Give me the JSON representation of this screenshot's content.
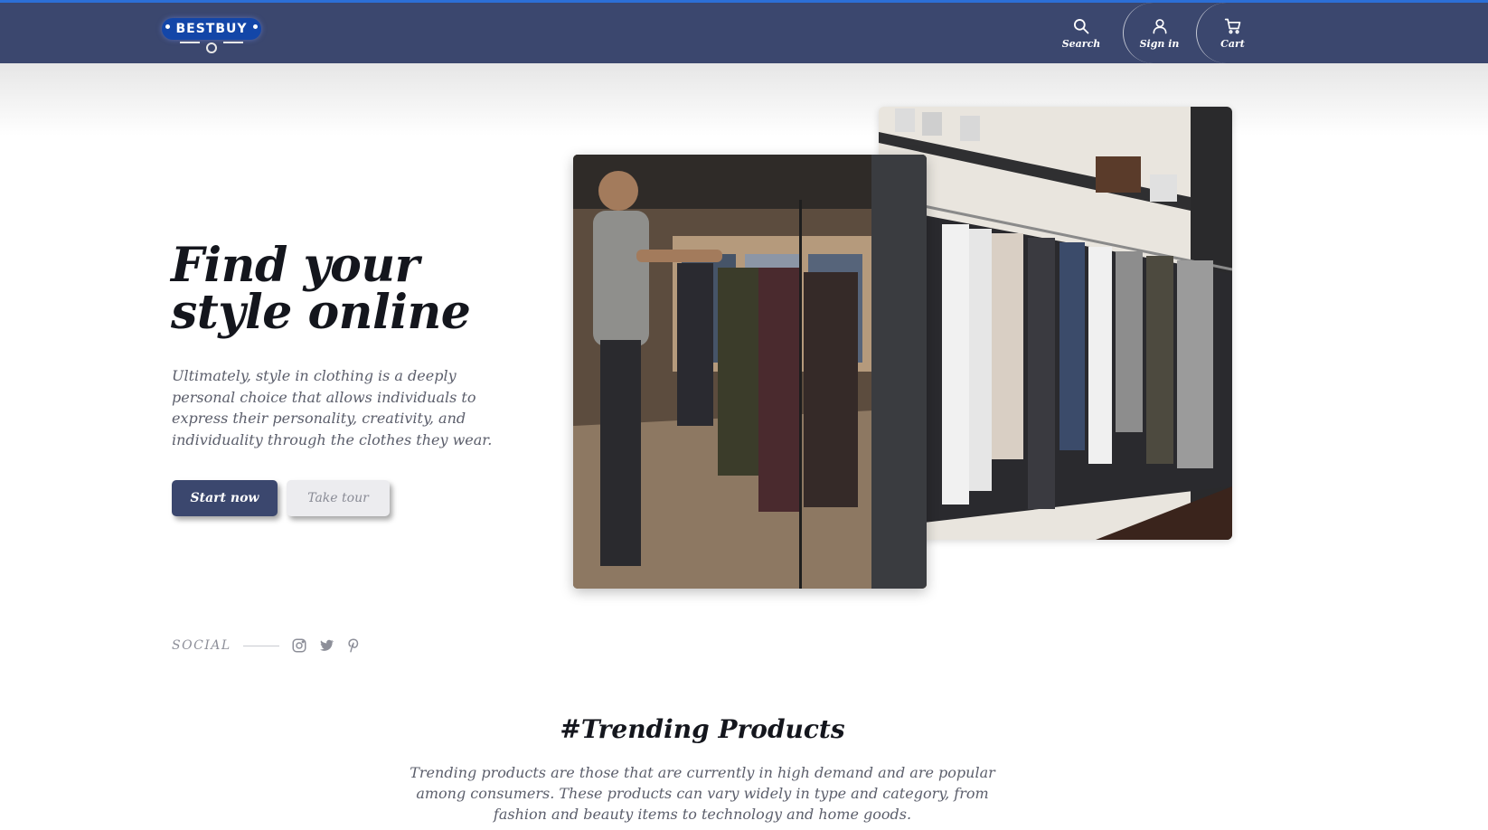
{
  "brand": {
    "logo_text": "BESTBUY",
    "nav_color": "#3b476e",
    "accent_color": "#2c6fd6",
    "logo_color": "#1346a8"
  },
  "nav": {
    "items": [
      {
        "label": "Search",
        "icon": "search-icon"
      },
      {
        "label": "Sign in",
        "icon": "user-icon"
      },
      {
        "label": "Cart",
        "icon": "cart-icon"
      }
    ]
  },
  "hero": {
    "title_line1": "Find your",
    "title_line2": "style online",
    "description": "Ultimately, style in clothing is a deeply personal choice that allows individuals to express their personality, creativity, and individuality through the clothes they wear.",
    "primary_button": "Start now",
    "secondary_button": "Take tour",
    "images": [
      {
        "alt": "Man browsing clothing rack in store",
        "icon": "photo"
      },
      {
        "alt": "Clothing rack in boutique",
        "icon": "photo"
      }
    ]
  },
  "social": {
    "label": "SOCIAL",
    "icons": [
      "instagram-icon",
      "twitter-icon",
      "pinterest-icon"
    ]
  },
  "trending": {
    "title": "#Trending Products",
    "description": "Trending products are those that are currently in high demand and are popular among consumers. These products can vary widely in type and category, from fashion and beauty items to technology and home goods."
  }
}
